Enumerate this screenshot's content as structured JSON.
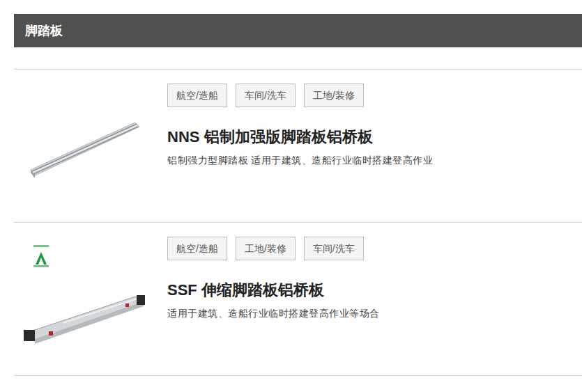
{
  "section": {
    "title": "脚踏板"
  },
  "products": [
    {
      "kind": "rail",
      "badge": false,
      "tags": [
        "航空/造船",
        "车间/洗车",
        "工地/装修"
      ],
      "title": "NNS 铝制加强版脚踏板铝桥板",
      "description": "铝制强力型脚踏板 适用于建筑、造船行业临时搭建登高作业"
    },
    {
      "kind": "telescopic",
      "badge": true,
      "tags": [
        "航空/造船",
        "工地/装修",
        "车间/洗车"
      ],
      "title": "SSF 伸缩脚踏板铝桥板",
      "description": "适用于建筑、造船行业临时搭建登高作业等场合"
    }
  ]
}
